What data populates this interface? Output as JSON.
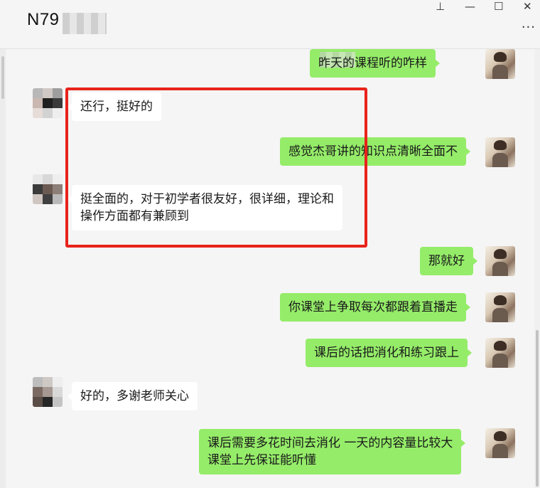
{
  "window": {
    "title": "N79",
    "controls": {
      "pin": "⊥",
      "minimize": "—",
      "maximize": "☐",
      "close": "✕"
    },
    "more": "···"
  },
  "messages": [
    {
      "side": "right",
      "text": "昨天的课程听的咋样"
    },
    {
      "side": "left",
      "text": "还行，挺好的"
    },
    {
      "side": "right",
      "text": "感觉杰哥讲的知识点清晰全面不"
    },
    {
      "side": "left",
      "lines": [
        "挺全面的，对于初学者很友好，很详细，理论和",
        "操作方面都有兼顾到"
      ]
    },
    {
      "side": "right",
      "text": "那就好"
    },
    {
      "side": "right",
      "text": "你课堂上争取每次都跟着直播走"
    },
    {
      "side": "right",
      "text": "课后的话把消化和练习跟上"
    },
    {
      "side": "left",
      "text": "好的，多谢老师关心"
    },
    {
      "side": "right",
      "lines": [
        "课后需要多花时间去消化 一天的内容量比较大",
        "课堂上先保证能听懂"
      ]
    }
  ],
  "colors": {
    "self_bubble": "#95ec69",
    "other_bubble": "#ffffff",
    "highlight_box": "#e8231b",
    "background": "#f5f5f5"
  },
  "icons": {
    "pin": "pin-icon",
    "minimize": "minimize-icon",
    "maximize": "maximize-icon",
    "close": "close-icon",
    "more": "more-icon"
  }
}
